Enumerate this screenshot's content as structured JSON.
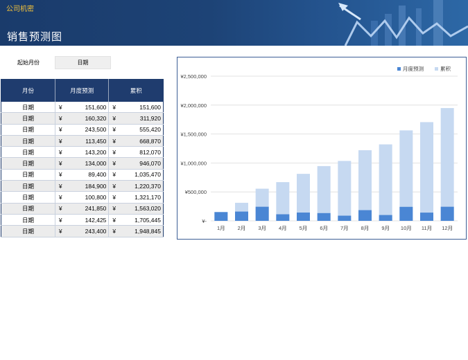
{
  "header": {
    "company": "公司机密",
    "title": "销售预测图"
  },
  "start": {
    "label": "起始月份",
    "value": "日期"
  },
  "table": {
    "headers": [
      "月份",
      "月度预测",
      "累积"
    ],
    "currency_symbol": "¥",
    "rows": [
      {
        "month": "日期",
        "monthly": "151,600",
        "cumulative": "151,600"
      },
      {
        "month": "日期",
        "monthly": "160,320",
        "cumulative": "311,920"
      },
      {
        "month": "日期",
        "monthly": "243,500",
        "cumulative": "555,420"
      },
      {
        "month": "日期",
        "monthly": "113,450",
        "cumulative": "668,870"
      },
      {
        "month": "日期",
        "monthly": "143,200",
        "cumulative": "812,070"
      },
      {
        "month": "日期",
        "monthly": "134,000",
        "cumulative": "946,070"
      },
      {
        "month": "日期",
        "monthly": "89,400",
        "cumulative": "1,035,470"
      },
      {
        "month": "日期",
        "monthly": "184,900",
        "cumulative": "1,220,370"
      },
      {
        "month": "日期",
        "monthly": "100,800",
        "cumulative": "1,321,170"
      },
      {
        "month": "日期",
        "monthly": "241,850",
        "cumulative": "1,563,020"
      },
      {
        "month": "日期",
        "monthly": "142,425",
        "cumulative": "1,705,445"
      },
      {
        "month": "日期",
        "monthly": "243,400",
        "cumulative": "1,948,845"
      }
    ]
  },
  "chart_data": {
    "type": "bar",
    "categories": [
      "1月",
      "2月",
      "3月",
      "4月",
      "5月",
      "6月",
      "7月",
      "8月",
      "9月",
      "10月",
      "11月",
      "12月"
    ],
    "series": [
      {
        "name": "月度预测",
        "color": "#4a86d4",
        "values": [
          151600,
          160320,
          243500,
          113450,
          143200,
          134000,
          89400,
          184900,
          100800,
          241850,
          142425,
          243400
        ]
      },
      {
        "name": "累积",
        "color": "#c6d9f1",
        "values": [
          151600,
          311920,
          555420,
          668870,
          812070,
          946070,
          1035470,
          1220370,
          1321170,
          1563020,
          1705445,
          1948845
        ]
      }
    ],
    "y_ticks": [
      {
        "value": 0,
        "label": "¥-"
      },
      {
        "value": 500000,
        "label": "¥500,000"
      },
      {
        "value": 1000000,
        "label": "¥1,000,000"
      },
      {
        "value": 1500000,
        "label": "¥1,500,000"
      },
      {
        "value": 2000000,
        "label": "¥2,000,000"
      },
      {
        "value": 2500000,
        "label": "¥2,500,000"
      }
    ],
    "ylim": [
      0,
      2500000
    ],
    "grid": true,
    "legend_position": "top-right"
  }
}
